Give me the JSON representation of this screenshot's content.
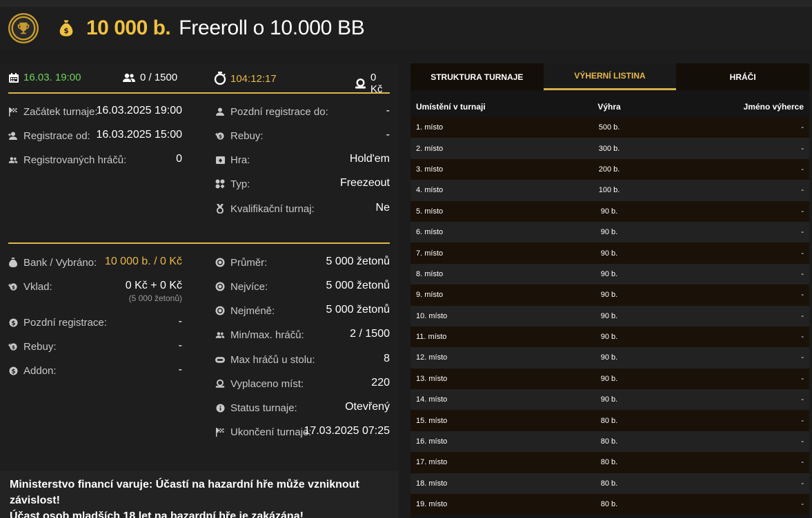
{
  "header": {
    "amount": "10 000 b.",
    "title": "Freeroll o 10.000 BB"
  },
  "statbar": {
    "date": "16.03. 19:00",
    "players": "0 / 1500",
    "timer": "104:12:17",
    "fee": "0 Kč"
  },
  "info_left": [
    {
      "label": "Začátek turnaje:",
      "value": "16.03.2025 19:00"
    },
    {
      "label": "Registrace od:",
      "value": "16.03.2025 15:00"
    },
    {
      "label": "Registrovaných hráčů:",
      "value": "0"
    }
  ],
  "info_right": [
    {
      "label": "Pozdní registrace do:",
      "value": "-"
    },
    {
      "label": "Rebuy:",
      "value": "-"
    },
    {
      "label": "Hra:",
      "value": "Hold'em"
    },
    {
      "label": "Typ:",
      "value": "Freezeout"
    },
    {
      "label": "Kvalifikační turnaj:",
      "value": "Ne"
    }
  ],
  "money_left": [
    {
      "label": "Bank / Vybráno:",
      "value": "10 000 b. / 0 Kč"
    },
    {
      "label": "Vklad:",
      "value": "0 Kč + 0 Kč",
      "sub": "(5 000 žetonů)"
    },
    {
      "label": "Pozdní registrace:",
      "value": "-"
    },
    {
      "label": "Rebuy:",
      "value": "-"
    },
    {
      "label": "Addon:",
      "value": "-"
    }
  ],
  "money_right": [
    {
      "label": "Průměr:",
      "value": "5 000 žetonů"
    },
    {
      "label": "Nejvíce:",
      "value": "5 000 žetonů"
    },
    {
      "label": "Nejméně:",
      "value": "5 000 žetonů"
    },
    {
      "label": "Min/max. hráčů:",
      "value": "2 / 1500"
    },
    {
      "label": "Max hráčů u stolu:",
      "value": "8"
    },
    {
      "label": "Vyplaceno míst:",
      "value": "220"
    },
    {
      "label": "Status turnaje:",
      "value": "Otevřený"
    },
    {
      "label": "Ukončení turnaje:",
      "value": "17.03.2025 07:25"
    }
  ],
  "warning": {
    "line1": "Ministerstvo financí varuje: Účastí na hazardní hře může vzniknout závislost!",
    "line2": "Účast osob mladších 18 let na hazardní hře je zakázána!"
  },
  "tabs": [
    "STRUKTURA TURNAJE",
    "VÝHERNÍ LISTINA",
    "HRÁČI"
  ],
  "table": {
    "headers": [
      "Umístění v turnaji",
      "Výhra",
      "Jméno výherce"
    ],
    "rows": [
      [
        "1. místo",
        "500 b.",
        "-"
      ],
      [
        "2. místo",
        "300 b.",
        "-"
      ],
      [
        "3. místo",
        "200 b.",
        "-"
      ],
      [
        "4. místo",
        "100 b.",
        "-"
      ],
      [
        "5. místo",
        "90 b.",
        "-"
      ],
      [
        "6. místo",
        "90 b.",
        "-"
      ],
      [
        "7. místo",
        "90 b.",
        "-"
      ],
      [
        "8. místo",
        "90 b.",
        "-"
      ],
      [
        "9. místo",
        "90 b.",
        "-"
      ],
      [
        "10. místo",
        "90 b.",
        "-"
      ],
      [
        "11. místo",
        "90 b.",
        "-"
      ],
      [
        "12. místo",
        "90 b.",
        "-"
      ],
      [
        "13. místo",
        "90 b.",
        "-"
      ],
      [
        "14. místo",
        "90 b.",
        "-"
      ],
      [
        "15. místo",
        "80 b.",
        "-"
      ],
      [
        "16. místo",
        "80 b.",
        "-"
      ],
      [
        "17. místo",
        "80 b.",
        "-"
      ],
      [
        "18. místo",
        "80 b.",
        "-"
      ],
      [
        "19. místo",
        "80 b.",
        "-"
      ]
    ]
  },
  "colors": {
    "accent": "#e8b84a",
    "green": "#6fd25a",
    "background": "#1c1c1c"
  }
}
